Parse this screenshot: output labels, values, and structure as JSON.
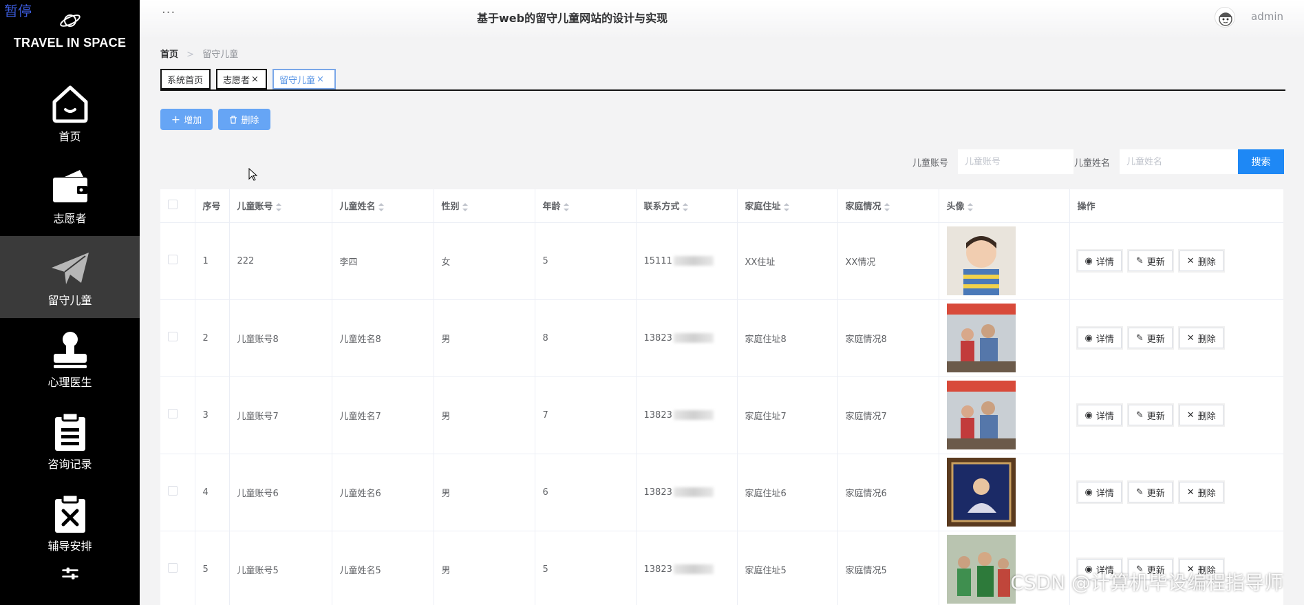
{
  "sidebar": {
    "pause_label": "暂停",
    "brand": "TRAVEL IN SPACE",
    "items": [
      {
        "label": "首页",
        "icon": "home-icon"
      },
      {
        "label": "志愿者",
        "icon": "wallet-icon"
      },
      {
        "label": "留守儿童",
        "icon": "paper-plane-icon",
        "active": true
      },
      {
        "label": "心理医生",
        "icon": "stamp-icon"
      },
      {
        "label": "咨询记录",
        "icon": "clipboard-icon"
      },
      {
        "label": "辅导安排",
        "icon": "clipboard-x-icon"
      },
      {
        "label": "",
        "icon": "sliders-icon"
      }
    ]
  },
  "header": {
    "title": "基于web的留守儿童网站的设计与实现",
    "user": "admin"
  },
  "breadcrumb": {
    "home": "首页",
    "current": "留守儿童"
  },
  "tabs": [
    {
      "label": "系统首页",
      "closable": false
    },
    {
      "label": "志愿者",
      "closable": true
    },
    {
      "label": "留守儿童",
      "closable": true,
      "active": true
    }
  ],
  "actions": {
    "add": "增加",
    "delete": "删除"
  },
  "search": {
    "account_label": "儿童账号",
    "account_placeholder": "儿童账号",
    "name_label": "儿童姓名",
    "name_placeholder": "儿童姓名",
    "button": "搜索"
  },
  "table": {
    "columns": [
      "序号",
      "儿童账号",
      "儿童姓名",
      "性别",
      "年龄",
      "联系方式",
      "家庭住址",
      "家庭情况",
      "头像",
      "操作"
    ],
    "rows": [
      {
        "index": "1",
        "account": "222",
        "name": "李四",
        "gender": "女",
        "age": "5",
        "phone": "15111",
        "address": "XX住址",
        "family": "XX情况"
      },
      {
        "index": "2",
        "account": "儿童账号8",
        "name": "儿童姓名8",
        "gender": "男",
        "age": "8",
        "phone": "13823",
        "address": "家庭住址8",
        "family": "家庭情况8"
      },
      {
        "index": "3",
        "account": "儿童账号7",
        "name": "儿童姓名7",
        "gender": "男",
        "age": "7",
        "phone": "13823",
        "address": "家庭住址7",
        "family": "家庭情况7"
      },
      {
        "index": "4",
        "account": "儿童账号6",
        "name": "儿童姓名6",
        "gender": "男",
        "age": "6",
        "phone": "13823",
        "address": "家庭住址6",
        "family": "家庭情况6"
      },
      {
        "index": "5",
        "account": "儿童账号5",
        "name": "儿童姓名5",
        "gender": "男",
        "age": "5",
        "phone": "13823",
        "address": "家庭住址5",
        "family": "家庭情况5"
      }
    ],
    "row_actions": {
      "detail": "详情",
      "update": "更新",
      "delete": "删除"
    }
  },
  "watermark": "CSDN @计算机毕设编程指导师",
  "colors": {
    "sidebar_bg": "#000000",
    "sidebar_active": "#3a3a3a",
    "primary": "#1e88f5",
    "action_btn": "#66a5f5"
  }
}
